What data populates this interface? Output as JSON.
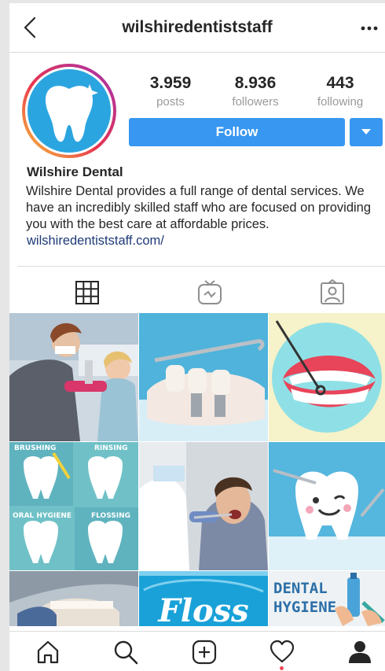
{
  "header": {
    "username": "wilshiredentiststaff"
  },
  "stats": [
    {
      "value": "3.959",
      "label": "posts"
    },
    {
      "value": "8.936",
      "label": "followers"
    },
    {
      "value": "443",
      "label": "following"
    }
  ],
  "actions": {
    "follow_label": "Follow"
  },
  "bio": {
    "name": "Wilshire Dental",
    "text": "Wilshire Dental provides a full range of dental services. We have an incredibly skilled staff who are focused on providing you with the best care at affordable prices.",
    "link": "wilshiredentiststaff.com/"
  },
  "tabs": [
    {
      "icon": "grid-icon",
      "active": true
    },
    {
      "icon": "igtv-icon",
      "active": false
    },
    {
      "icon": "tagged-icon",
      "active": false
    }
  ],
  "posts": {
    "tile5": {
      "labels": [
        "BRUSHING",
        "RINSING",
        "ORAL HYGIENE",
        "FLOSSING"
      ]
    },
    "tile8": {
      "text": "Floss"
    },
    "tile9": {
      "line1": "DENTAL",
      "line2": "HYGIENE"
    }
  },
  "colors": {
    "accent": "#3897f0",
    "link": "#1f3a78",
    "notification": "#ed4956"
  },
  "bottom_nav": [
    {
      "icon": "home-icon"
    },
    {
      "icon": "search-icon"
    },
    {
      "icon": "add-post-icon"
    },
    {
      "icon": "heart-icon"
    },
    {
      "icon": "profile-icon"
    }
  ]
}
